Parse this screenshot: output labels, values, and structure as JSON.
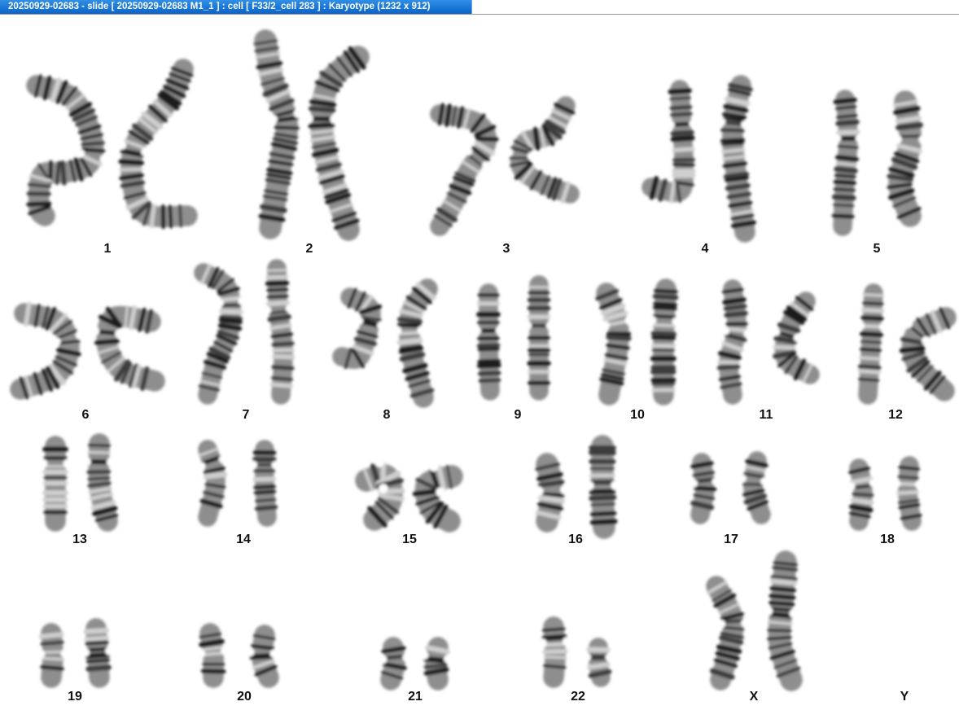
{
  "window": {
    "title": "20250929-02683 - slide [ 20250929-02683 M1_1 ] : cell [ F33/2_cell 283 ] : Karyotype  (1232 x 912)"
  },
  "karyotype": {
    "labels": [
      "1",
      "2",
      "3",
      "4",
      "5",
      "6",
      "7",
      "8",
      "9",
      "10",
      "11",
      "12",
      "13",
      "14",
      "15",
      "16",
      "17",
      "18",
      "19",
      "20",
      "21",
      "22",
      "X",
      "Y"
    ]
  }
}
